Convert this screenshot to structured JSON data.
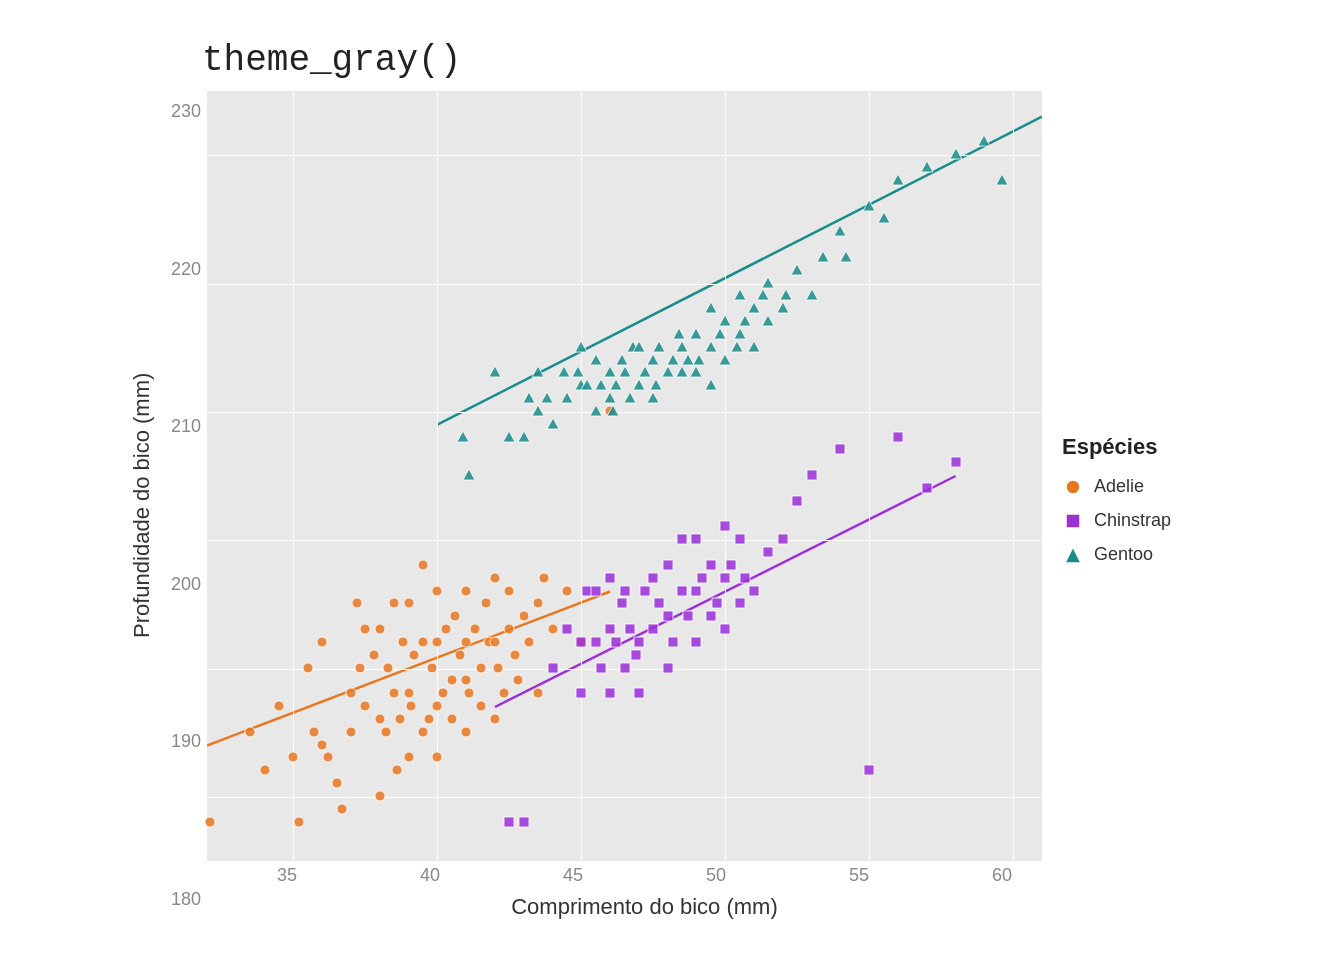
{
  "title": "theme_gray()",
  "y_axis_label": "Profundidade do bico (mm)",
  "x_axis_label": "Comprimento do bico (mm)",
  "y_ticks": [
    "230",
    "220",
    "210",
    "200",
    "190",
    "180"
  ],
  "x_ticks": [
    "35",
    "40",
    "45",
    "50",
    "55",
    "60"
  ],
  "legend": {
    "title": "Espécies",
    "items": [
      {
        "label": "Adelie",
        "color": "#E87722",
        "shape": "circle"
      },
      {
        "label": "Chinstrap",
        "color": "#9B30D9",
        "shape": "square"
      },
      {
        "label": "Gentoo",
        "color": "#1B8C8C",
        "shape": "triangle"
      }
    ]
  },
  "colors": {
    "adelie": "#E87722",
    "chinstrap": "#9B30D9",
    "gentoo": "#1B8C8C",
    "background": "#e8e8e8",
    "grid": "#ffffff"
  },
  "adelie_points": [
    [
      32.1,
      178
    ],
    [
      33.5,
      185
    ],
    [
      34.0,
      182
    ],
    [
      34.5,
      187
    ],
    [
      35.0,
      183
    ],
    [
      35.2,
      178
    ],
    [
      35.5,
      190
    ],
    [
      35.7,
      185
    ],
    [
      36.0,
      184
    ],
    [
      36.0,
      192
    ],
    [
      36.2,
      183
    ],
    [
      36.5,
      181
    ],
    [
      36.7,
      179
    ],
    [
      37.0,
      188
    ],
    [
      37.0,
      185
    ],
    [
      37.2,
      195
    ],
    [
      37.3,
      190
    ],
    [
      37.5,
      187
    ],
    [
      37.5,
      193
    ],
    [
      37.8,
      191
    ],
    [
      38.0,
      180
    ],
    [
      38.0,
      186
    ],
    [
      38.0,
      193
    ],
    [
      38.2,
      185
    ],
    [
      38.3,
      190
    ],
    [
      38.5,
      188
    ],
    [
      38.5,
      195
    ],
    [
      38.6,
      182
    ],
    [
      38.7,
      186
    ],
    [
      38.8,
      192
    ],
    [
      39.0,
      183
    ],
    [
      39.0,
      188
    ],
    [
      39.0,
      195
    ],
    [
      39.1,
      187
    ],
    [
      39.2,
      191
    ],
    [
      39.5,
      185
    ],
    [
      39.5,
      192
    ],
    [
      39.5,
      198
    ],
    [
      39.7,
      186
    ],
    [
      39.8,
      190
    ],
    [
      40.0,
      183
    ],
    [
      40.0,
      187
    ],
    [
      40.0,
      192
    ],
    [
      40.0,
      196
    ],
    [
      40.2,
      188
    ],
    [
      40.3,
      193
    ],
    [
      40.5,
      186
    ],
    [
      40.5,
      189
    ],
    [
      40.6,
      194
    ],
    [
      40.8,
      191
    ],
    [
      41.0,
      185
    ],
    [
      41.0,
      189
    ],
    [
      41.0,
      192
    ],
    [
      41.0,
      196
    ],
    [
      41.1,
      188
    ],
    [
      41.3,
      193
    ],
    [
      41.5,
      190
    ],
    [
      41.5,
      187
    ],
    [
      41.7,
      195
    ],
    [
      41.8,
      192
    ],
    [
      42.0,
      186
    ],
    [
      42.0,
      192
    ],
    [
      42.0,
      197
    ],
    [
      42.1,
      190
    ],
    [
      42.3,
      188
    ],
    [
      42.5,
      193
    ],
    [
      42.5,
      196
    ],
    [
      42.7,
      191
    ],
    [
      42.8,
      189
    ],
    [
      43.0,
      194
    ],
    [
      43.2,
      192
    ],
    [
      43.5,
      188
    ],
    [
      43.5,
      195
    ],
    [
      43.7,
      197
    ],
    [
      44.0,
      193
    ],
    [
      44.5,
      196
    ],
    [
      45.0,
      192
    ],
    [
      46.0,
      210
    ]
  ],
  "chinstrap_points": [
    [
      42.5,
      178
    ],
    [
      43.0,
      178
    ],
    [
      44.0,
      190
    ],
    [
      44.5,
      193
    ],
    [
      45.0,
      188
    ],
    [
      45.0,
      192
    ],
    [
      45.2,
      196
    ],
    [
      45.5,
      192
    ],
    [
      45.5,
      196
    ],
    [
      45.7,
      190
    ],
    [
      46.0,
      188
    ],
    [
      46.0,
      193
    ],
    [
      46.0,
      197
    ],
    [
      46.2,
      192
    ],
    [
      46.4,
      195
    ],
    [
      46.5,
      190
    ],
    [
      46.5,
      196
    ],
    [
      46.7,
      193
    ],
    [
      46.9,
      191
    ],
    [
      47.0,
      188
    ],
    [
      47.0,
      192
    ],
    [
      47.2,
      196
    ],
    [
      47.5,
      193
    ],
    [
      47.5,
      197
    ],
    [
      47.7,
      195
    ],
    [
      48.0,
      190
    ],
    [
      48.0,
      194
    ],
    [
      48.0,
      198
    ],
    [
      48.2,
      192
    ],
    [
      48.5,
      196
    ],
    [
      48.5,
      200
    ],
    [
      48.7,
      194
    ],
    [
      49.0,
      192
    ],
    [
      49.0,
      196
    ],
    [
      49.0,
      200
    ],
    [
      49.2,
      197
    ],
    [
      49.5,
      194
    ],
    [
      49.5,
      198
    ],
    [
      49.7,
      195
    ],
    [
      50.0,
      193
    ],
    [
      50.0,
      197
    ],
    [
      50.0,
      201
    ],
    [
      50.2,
      198
    ],
    [
      50.5,
      195
    ],
    [
      50.5,
      200
    ],
    [
      50.7,
      197
    ],
    [
      51.0,
      196
    ],
    [
      51.5,
      199
    ],
    [
      52.0,
      200
    ],
    [
      52.5,
      203
    ],
    [
      53.0,
      205
    ],
    [
      54.0,
      207
    ],
    [
      55.0,
      182
    ],
    [
      56.0,
      208
    ],
    [
      57.0,
      204
    ],
    [
      58.0,
      206
    ]
  ],
  "gentoo_points": [
    [
      40.9,
      208
    ],
    [
      41.1,
      205
    ],
    [
      42.0,
      213
    ],
    [
      42.5,
      208
    ],
    [
      43.0,
      208
    ],
    [
      43.2,
      211
    ],
    [
      43.5,
      210
    ],
    [
      43.5,
      213
    ],
    [
      43.8,
      211
    ],
    [
      44.0,
      209
    ],
    [
      44.4,
      213
    ],
    [
      44.5,
      211
    ],
    [
      44.9,
      213
    ],
    [
      45.0,
      212
    ],
    [
      45.0,
      215
    ],
    [
      45.2,
      212
    ],
    [
      45.5,
      210
    ],
    [
      45.5,
      214
    ],
    [
      45.7,
      212
    ],
    [
      46.0,
      211
    ],
    [
      46.0,
      213
    ],
    [
      46.1,
      210
    ],
    [
      46.2,
      212
    ],
    [
      46.4,
      214
    ],
    [
      46.5,
      213
    ],
    [
      46.7,
      211
    ],
    [
      46.8,
      215
    ],
    [
      47.0,
      212
    ],
    [
      47.0,
      215
    ],
    [
      47.2,
      213
    ],
    [
      47.5,
      211
    ],
    [
      47.5,
      214
    ],
    [
      47.6,
      212
    ],
    [
      47.7,
      215
    ],
    [
      48.0,
      213
    ],
    [
      48.2,
      214
    ],
    [
      48.4,
      216
    ],
    [
      48.5,
      213
    ],
    [
      48.5,
      215
    ],
    [
      48.7,
      214
    ],
    [
      49.0,
      213
    ],
    [
      49.0,
      216
    ],
    [
      49.1,
      214
    ],
    [
      49.5,
      212
    ],
    [
      49.5,
      215
    ],
    [
      49.5,
      218
    ],
    [
      49.8,
      216
    ],
    [
      50.0,
      214
    ],
    [
      50.0,
      217
    ],
    [
      50.4,
      215
    ],
    [
      50.5,
      216
    ],
    [
      50.5,
      219
    ],
    [
      50.7,
      217
    ],
    [
      51.0,
      215
    ],
    [
      51.0,
      218
    ],
    [
      51.3,
      219
    ],
    [
      51.5,
      217
    ],
    [
      51.5,
      220
    ],
    [
      52.0,
      218
    ],
    [
      52.1,
      219
    ],
    [
      52.5,
      221
    ],
    [
      53.0,
      219
    ],
    [
      53.4,
      222
    ],
    [
      54.0,
      224
    ],
    [
      54.2,
      222
    ],
    [
      55.0,
      226
    ],
    [
      55.5,
      225
    ],
    [
      56.0,
      228
    ],
    [
      57.0,
      229
    ],
    [
      58.0,
      230
    ],
    [
      59.0,
      231
    ],
    [
      59.6,
      228
    ]
  ],
  "trend_lines": {
    "adelie": {
      "x1_pct": 10,
      "y1_pct": 84,
      "x2_pct": 56,
      "y2_pct": 62
    },
    "chinstrap": {
      "x1_pct": 28,
      "y1_pct": 78,
      "x2_pct": 95,
      "y2_pct": 40
    },
    "gentoo": {
      "x1_pct": 35,
      "y1_pct": 58,
      "x2_pct": 97,
      "y2_pct": 5
    }
  }
}
